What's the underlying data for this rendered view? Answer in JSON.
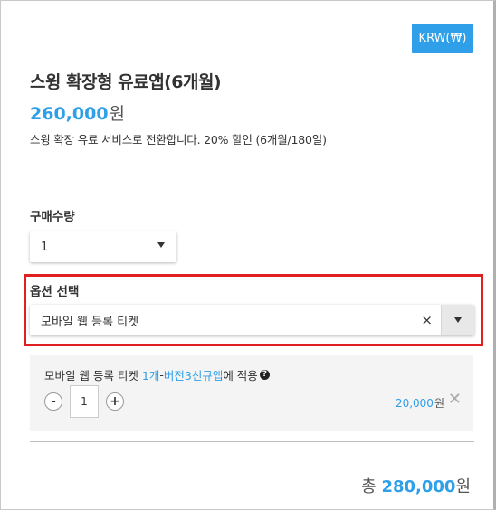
{
  "currency_button": "KRW(₩)",
  "product": {
    "title": "스윙 확장형 유료앱(6개월)",
    "price": "260,000",
    "price_unit": "원",
    "description": "스윙 확장 유료 서비스로 전환합니다. 20% 할인 (6개월/180일)"
  },
  "quantity": {
    "label": "구매수량",
    "selected": "1"
  },
  "option": {
    "label": "옵션 선택",
    "selected": "모바일 웹 등록 티켓",
    "clear_symbol": "×"
  },
  "selected_item": {
    "name": "모바일 웹 등록 티켓",
    "count": "1개",
    "separator": " - ",
    "target": "버전3신규앱",
    "suffix": "에 적용",
    "help_symbol": "?",
    "quantity": "1",
    "decrement": "-",
    "increment": "+",
    "price": "20,000",
    "price_unit": "원",
    "remove_symbol": "✕"
  },
  "total": {
    "label": "총",
    "amount": "280,000",
    "unit": "원"
  },
  "colors": {
    "accent": "#2e9fe8",
    "highlight_border": "#e02020"
  }
}
